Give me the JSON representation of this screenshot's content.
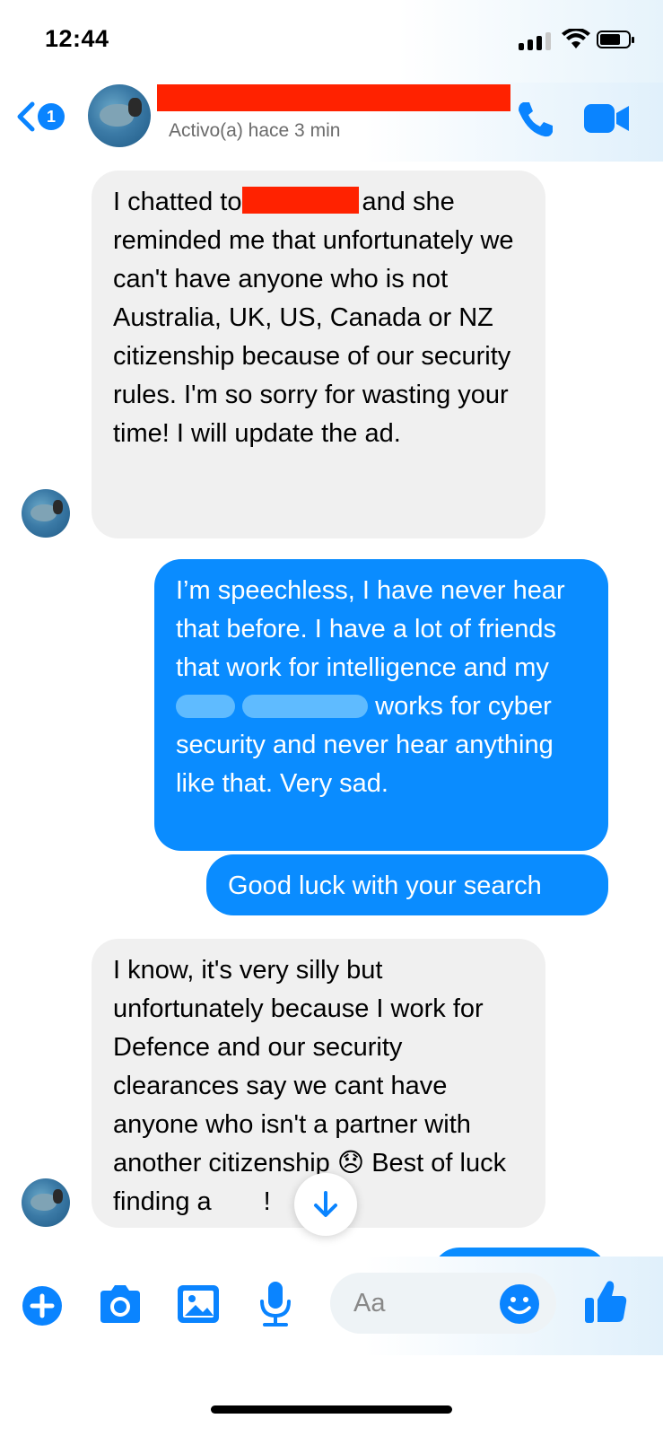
{
  "status_bar": {
    "time": "12:44"
  },
  "header": {
    "back_badge": "1",
    "active_status": "Activo(a) hace 3 min",
    "icons": [
      "back-chevron-icon",
      "phone-icon",
      "video-camera-icon"
    ]
  },
  "messages": [
    {
      "direction": "incoming",
      "line1_before": "I chatted to",
      "line1_after": "and she",
      "rest": "reminded me that unfortunately we can't have anyone who is not Australia, UK, US, Canada or NZ citizenship because of our security rules. I'm so sorry for wasting your time! I will update the ad."
    },
    {
      "direction": "outgoing",
      "part1": "I’m speechless, I have never hear that before. I have a lot of friends that work for intelligence and my",
      "part2": "works for cyber security and never hear anything like that. Very sad."
    },
    {
      "direction": "outgoing",
      "text": "Good luck with your search"
    },
    {
      "direction": "incoming",
      "part1": "I know, it's very silly but unfortunately because I work for Defence and our security clearances say we cant have anyone who isn't a partner with another citizenship",
      "emoji": "😞",
      "part2": "Best of",
      "part3_before": "luck finding a",
      "part3_after": "!"
    }
  ],
  "composer": {
    "placeholder": "Aa",
    "icons": [
      "plus-icon",
      "camera-icon",
      "image-icon",
      "microphone-icon",
      "emoji-icon",
      "thumbs-up-icon"
    ]
  },
  "colors": {
    "accent": "#0a84ff",
    "outgoing_bubble": "#0a8cff",
    "incoming_bubble": "#f0f0f0",
    "redaction_red": "#ff2200"
  }
}
